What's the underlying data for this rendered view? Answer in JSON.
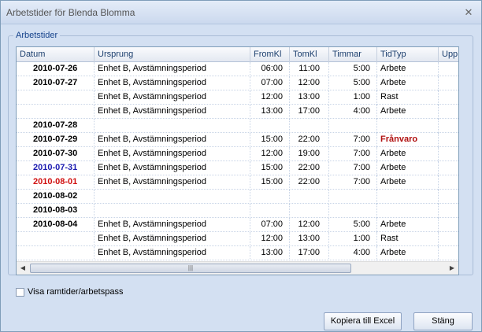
{
  "window": {
    "title": "Arbetstider för Blenda Blomma",
    "close_glyph": "✕"
  },
  "group": {
    "legend": "Arbetstider"
  },
  "columns": [
    "Datum",
    "Ursprung",
    "FromKl",
    "TomKl",
    "Timmar",
    "TidTyp",
    "Upp"
  ],
  "colors": {
    "blue_date": "#1a1ab0",
    "red_date": "#d01010",
    "franvaro": "#b01010"
  },
  "rows": [
    {
      "datum": "2010-07-26",
      "datum_color": "",
      "ursprung": "Enhet B, Avstämningsperiod",
      "from": "06:00",
      "tom": "11:00",
      "timmar": "5:00",
      "typ": "Arbete",
      "typ_color": ""
    },
    {
      "datum": "2010-07-27",
      "datum_color": "",
      "ursprung": "Enhet B, Avstämningsperiod",
      "from": "07:00",
      "tom": "12:00",
      "timmar": "5:00",
      "typ": "Arbete",
      "typ_color": ""
    },
    {
      "datum": "",
      "datum_color": "",
      "ursprung": "Enhet B, Avstämningsperiod",
      "from": "12:00",
      "tom": "13:00",
      "timmar": "1:00",
      "typ": "Rast",
      "typ_color": ""
    },
    {
      "datum": "",
      "datum_color": "",
      "ursprung": "Enhet B, Avstämningsperiod",
      "from": "13:00",
      "tom": "17:00",
      "timmar": "4:00",
      "typ": "Arbete",
      "typ_color": ""
    },
    {
      "datum": "2010-07-28",
      "datum_color": "",
      "ursprung": "",
      "from": "",
      "tom": "",
      "timmar": "",
      "typ": "",
      "typ_color": ""
    },
    {
      "datum": "2010-07-29",
      "datum_color": "",
      "ursprung": "Enhet B, Avstämningsperiod",
      "from": "15:00",
      "tom": "22:00",
      "timmar": "7:00",
      "typ": "Frånvaro",
      "typ_color": "#b01010"
    },
    {
      "datum": "2010-07-30",
      "datum_color": "",
      "ursprung": "Enhet B, Avstämningsperiod",
      "from": "12:00",
      "tom": "19:00",
      "timmar": "7:00",
      "typ": "Arbete",
      "typ_color": ""
    },
    {
      "datum": "2010-07-31",
      "datum_color": "#1a1ab0",
      "ursprung": "Enhet B, Avstämningsperiod",
      "from": "15:00",
      "tom": "22:00",
      "timmar": "7:00",
      "typ": "Arbete",
      "typ_color": ""
    },
    {
      "datum": "2010-08-01",
      "datum_color": "#d01010",
      "ursprung": "Enhet B, Avstämningsperiod",
      "from": "15:00",
      "tom": "22:00",
      "timmar": "7:00",
      "typ": "Arbete",
      "typ_color": ""
    },
    {
      "datum": "2010-08-02",
      "datum_color": "",
      "ursprung": "",
      "from": "",
      "tom": "",
      "timmar": "",
      "typ": "",
      "typ_color": ""
    },
    {
      "datum": "2010-08-03",
      "datum_color": "",
      "ursprung": "",
      "from": "",
      "tom": "",
      "timmar": "",
      "typ": "",
      "typ_color": ""
    },
    {
      "datum": "2010-08-04",
      "datum_color": "",
      "ursprung": "Enhet B, Avstämningsperiod",
      "from": "07:00",
      "tom": "12:00",
      "timmar": "5:00",
      "typ": "Arbete",
      "typ_color": ""
    },
    {
      "datum": "",
      "datum_color": "",
      "ursprung": "Enhet B, Avstämningsperiod",
      "from": "12:00",
      "tom": "13:00",
      "timmar": "1:00",
      "typ": "Rast",
      "typ_color": ""
    },
    {
      "datum": "",
      "datum_color": "",
      "ursprung": "Enhet B, Avstämningsperiod",
      "from": "13:00",
      "tom": "17:00",
      "timmar": "4:00",
      "typ": "Arbete",
      "typ_color": ""
    }
  ],
  "scroll": {
    "up": "▲",
    "down": "▼",
    "left": "◀",
    "right": "▶",
    "grip": "|||"
  },
  "footer": {
    "checkbox_label": "Visa ramtider/arbetspass",
    "checkbox_checked": false,
    "excel_button": "Kopiera till Excel",
    "close_button": "Stäng"
  }
}
